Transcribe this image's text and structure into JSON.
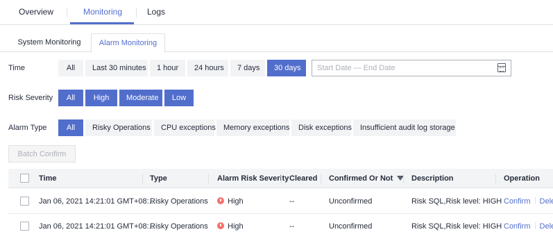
{
  "top_tabs": [
    {
      "label": "Overview"
    },
    {
      "label": "Monitoring"
    },
    {
      "label": "Logs"
    }
  ],
  "sub_tabs": [
    {
      "label": "System Monitoring"
    },
    {
      "label": "Alarm Monitoring"
    }
  ],
  "time_filter": {
    "label": "Time",
    "options": [
      "All",
      "Last 30 minutes",
      "1 hour",
      "24 hours",
      "7 days",
      "30 days"
    ],
    "selected": "30 days",
    "date_placeholder": "Start Date  —  End Date"
  },
  "risk_filter": {
    "label": "Risk Severity",
    "options": [
      "All",
      "High",
      "Moderate",
      "Low"
    ],
    "selected": [
      "All",
      "High",
      "Moderate",
      "Low"
    ]
  },
  "alarm_type_filter": {
    "label": "Alarm Type",
    "options": [
      "All",
      "Risky Operations",
      "CPU exceptions",
      "Memory exceptions",
      "Disk exceptions",
      "Insufficient audit log storage"
    ],
    "selected": "All"
  },
  "batch_confirm_label": "Batch Confirm",
  "table": {
    "columns": [
      "Time",
      "Type",
      "Alarm Risk Severity",
      "Cleared",
      "Confirmed Or Not",
      "Description",
      "Operation"
    ],
    "rows": [
      {
        "time": "Jan 06, 2021 14:21:01 GMT+08:...",
        "type": "Risky Operations",
        "severity": "High",
        "cleared": "--",
        "confirmed": "Unconfirmed",
        "description": "Risk SQL,Risk level: HIGH",
        "op_confirm": "Confirm",
        "op_delete": "Delet"
      },
      {
        "time": "Jan 06, 2021 14:21:01 GMT+08:...",
        "type": "Risky Operations",
        "severity": "High",
        "cleared": "--",
        "confirmed": "Unconfirmed",
        "description": "Risk SQL,Risk level: HIGH",
        "op_confirm": "Confirm",
        "op_delete": "Delet"
      }
    ]
  },
  "colors": {
    "accent": "#526ecc",
    "danger": "#f66f6a",
    "border": "#dfe1e6"
  }
}
